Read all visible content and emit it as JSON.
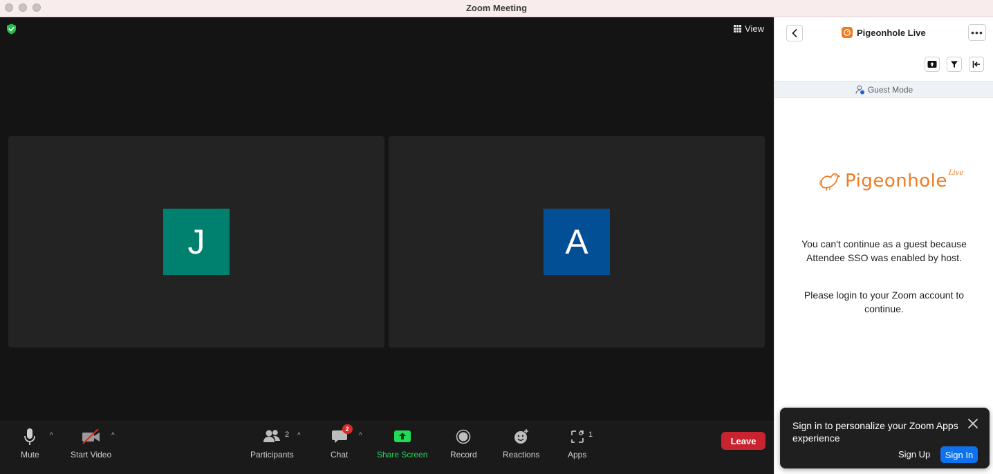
{
  "window": {
    "title": "Zoom Meeting"
  },
  "meeting": {
    "view_label": "View",
    "participants": [
      {
        "initial": "J",
        "color": "#00806f"
      },
      {
        "initial": "A",
        "color": "#034f96"
      }
    ]
  },
  "toolbar": {
    "mute_label": "Mute",
    "video_label": "Start Video",
    "participants_label": "Participants",
    "participants_count": "2",
    "chat_label": "Chat",
    "chat_badge": "2",
    "share_label": "Share Screen",
    "record_label": "Record",
    "reactions_label": "Reactions",
    "apps_label": "Apps",
    "apps_count": "1",
    "leave_label": "Leave",
    "share_color": "#23d959",
    "leave_color": "#c9232f"
  },
  "panel": {
    "app_title": "Pigeonhole Live",
    "guest_mode": "Guest Mode",
    "brand_word": "Pigeonhole",
    "brand_live": "Live",
    "message_1": "You can't continue as a guest because Attendee SSO was enabled by host.",
    "message_2": "Please login to your Zoom account to continue.",
    "brand_color": "#f07b21"
  },
  "toast": {
    "text": "Sign in to personalize your Zoom Apps experience",
    "signup_label": "Sign Up",
    "signin_label": "Sign In"
  }
}
